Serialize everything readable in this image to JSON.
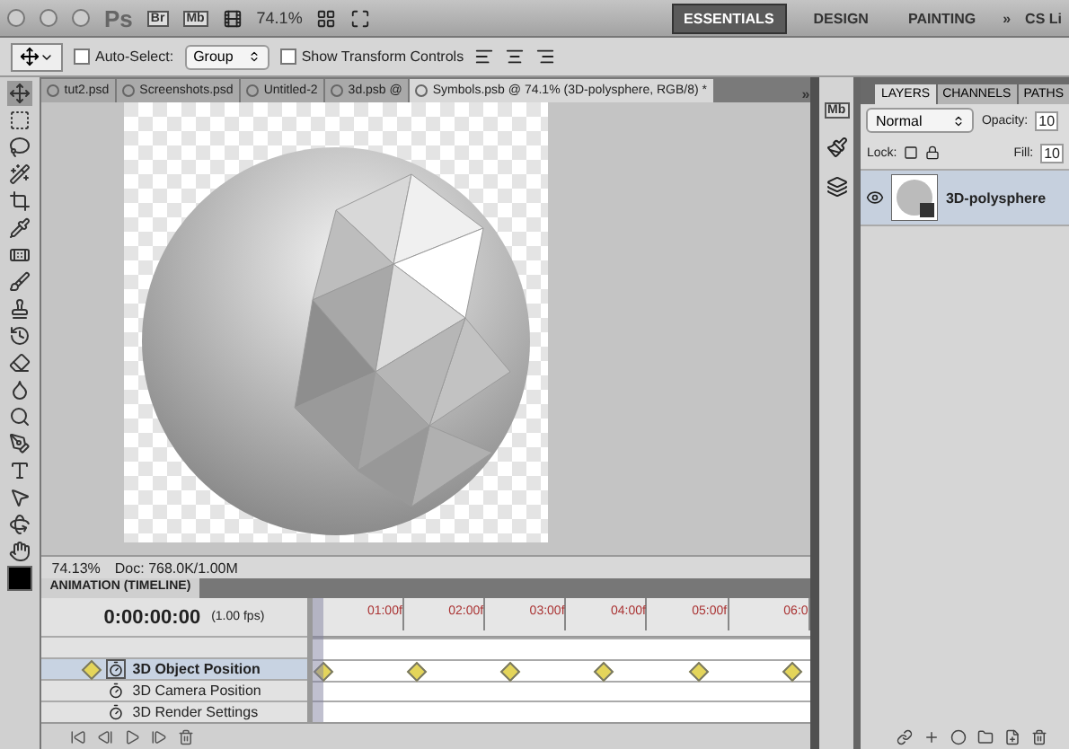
{
  "app_bar": {
    "app_mark": "Ps",
    "bridge": "Br",
    "mini_bridge": "Mb",
    "zoom": "74.1%",
    "workspaces": [
      {
        "label": "ESSENTIALS",
        "selected": true
      },
      {
        "label": "DESIGN",
        "selected": false
      },
      {
        "label": "PAINTING",
        "selected": false
      }
    ],
    "more": "»",
    "cs_live": "CS Li"
  },
  "options_bar": {
    "auto_select": {
      "label": "Auto-Select:",
      "checked": false
    },
    "auto_select_target": "Group",
    "transform_controls": {
      "label": "Show Transform Controls",
      "checked": false
    }
  },
  "document_tabs": [
    {
      "label": "tut2.psd",
      "selected": false
    },
    {
      "label": "Screenshots.psd",
      "selected": false
    },
    {
      "label": "Untitled-2",
      "selected": false
    },
    {
      "label": "3d.psb @",
      "selected": false
    },
    {
      "label": "Symbols.psb @ 74.1% (3D-polysphere, RGB/8) *",
      "selected": true
    }
  ],
  "tab_overflow": "»",
  "status_bar": {
    "zoom": "74.13%",
    "doc_size": "Doc: 768.0K/1.00M"
  },
  "timeline": {
    "title": "ANIMATION (TIMELINE)",
    "timecode": "0:00:00:00",
    "fps": "(1.00 fps)",
    "ruler": [
      "01:00f",
      "02:00f",
      "03:00f",
      "04:00f",
      "05:00f",
      "06:0"
    ],
    "tracks": [
      {
        "label": "3D Object Position",
        "selected": true,
        "animated": true,
        "keyframes": [
          true,
          true,
          true,
          true,
          true,
          true
        ]
      },
      {
        "label": "3D Camera Position",
        "selected": false,
        "animated": false
      },
      {
        "label": "3D Render Settings",
        "selected": false,
        "animated": false
      }
    ]
  },
  "dock": {
    "mini_bridge": "Mb"
  },
  "layers_panel": {
    "tabs": [
      {
        "label": "LAYERS",
        "selected": true
      },
      {
        "label": "CHANNELS",
        "selected": false
      },
      {
        "label": "PATHS",
        "selected": false
      }
    ],
    "blend_mode": "Normal",
    "opacity_label": "Opacity:",
    "opacity": "10",
    "lock_label": "Lock:",
    "fill_label": "Fill:",
    "fill": "10",
    "layers": [
      {
        "name": "3D-polysphere",
        "visible": true,
        "selected": true
      }
    ]
  }
}
